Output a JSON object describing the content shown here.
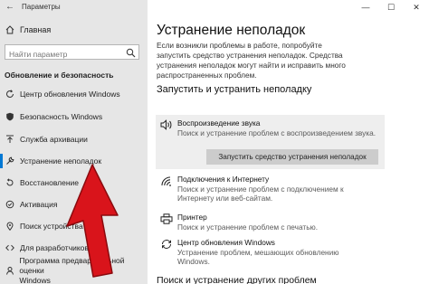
{
  "window": {
    "title": "Параметры",
    "controls": {
      "minimize": "—",
      "maximize": "☐",
      "close": "✕"
    }
  },
  "sidebar": {
    "home": "Главная",
    "search_placeholder": "Найти параметр",
    "section": "Обновление и безопасность",
    "items": [
      {
        "label": "Центр обновления Windows",
        "icon": "sync-icon"
      },
      {
        "label": "Безопасность Windows",
        "icon": "shield-icon"
      },
      {
        "label": "Служба архивации",
        "icon": "backup-icon"
      },
      {
        "label": "Устранение неполадок",
        "icon": "wrench-icon",
        "active": true
      },
      {
        "label": "Восстановление",
        "icon": "recovery-icon"
      },
      {
        "label": "Активация",
        "icon": "activation-icon"
      },
      {
        "label": "Поиск устройства",
        "icon": "find-device-icon"
      },
      {
        "label": "Для разработчиков",
        "icon": "developer-icon"
      },
      {
        "label_line1": "Программа предварительной оценки",
        "label_line2": "Windows",
        "icon": "insider-icon"
      }
    ]
  },
  "main": {
    "title": "Устранение неполадок",
    "intro": "Если возникли проблемы в работе, попробуйте запустить средство устранения неполадок. Средства устранения неполадок могут найти и исправить много распространенных проблем.",
    "section": "Запустить и устранить неполадку",
    "tiles": [
      {
        "name": "Воспроизведение звука",
        "desc": "Поиск и устранение проблем с воспроизведением звука.",
        "icon": "speaker-icon"
      },
      {
        "name": "Подключения к Интернету",
        "desc_line1": "Поиск и устранение проблем с подключением к",
        "desc_line2": "Интернету или веб-сайтам.",
        "icon": "wifi-icon"
      },
      {
        "name": "Принтер",
        "desc": "Поиск и устранение проблем с печатью.",
        "icon": "printer-icon"
      },
      {
        "name": "Центр обновления Windows",
        "desc_line1": "Устранение проблем, мешающих обновлению",
        "desc_line2": "Windows.",
        "icon": "sync-icon"
      }
    ],
    "run_button": "Запустить средство устранения неполадок",
    "more": "Поиск и устранение других проблем"
  },
  "colors": {
    "accent": "#0078d4",
    "sidebar_bg": "#e6e6e6",
    "arrow": "#d9141b"
  }
}
